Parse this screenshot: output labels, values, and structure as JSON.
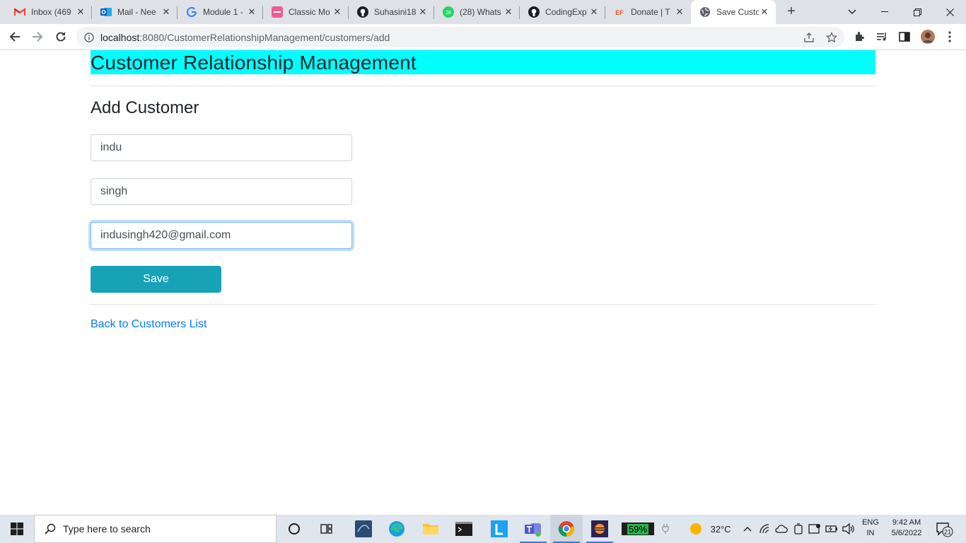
{
  "browser": {
    "tabs": [
      {
        "title": "Inbox (469",
        "icon": "gmail-icon"
      },
      {
        "title": "Mail - Nee",
        "icon": "outlook-icon"
      },
      {
        "title": "Module 1 -",
        "icon": "google-icon"
      },
      {
        "title": "Classic Mo",
        "icon": "classic-models-icon"
      },
      {
        "title": "Suhasini18",
        "icon": "github-icon"
      },
      {
        "title": "(28) Whats",
        "icon": "whatsapp-icon"
      },
      {
        "title": "CodingExp",
        "icon": "github-icon"
      },
      {
        "title": "Donate | T",
        "icon": "ef-icon"
      },
      {
        "title": "Save Custo",
        "icon": "globe-icon"
      }
    ],
    "whatsapp_badge": "28",
    "ef_badge": "EF",
    "url_host": "localhost",
    "url_path": ":8080/CustomerRelationshipManagement/customers/add"
  },
  "page": {
    "header": "Customer Relationship Management",
    "title": "Add Customer",
    "fields": {
      "first_name": "indu",
      "last_name": "singh",
      "email": "indusingh420@gmail.com"
    },
    "save_label": "Save",
    "back_link": "Back to Customers List",
    "colors": {
      "header_bg": "#00ffff",
      "save_bg": "#17a2b8",
      "link": "#007bff"
    }
  },
  "taskbar": {
    "search_placeholder": "Type here to search",
    "battery": "59%",
    "temperature": "32°C",
    "lang_top": "ENG",
    "lang_bottom": "IN",
    "time": "9:42 AM",
    "date": "5/6/2022",
    "notifications": "21"
  }
}
